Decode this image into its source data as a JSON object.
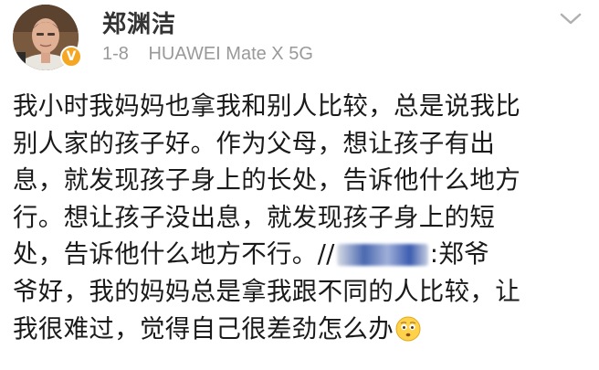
{
  "post": {
    "username": "郑渊洁",
    "time": "1-8",
    "device": "HUAWEI Mate X 5G",
    "verified_badge": "V",
    "icons": {
      "avatar": "user-avatar",
      "verified": "verified-badge-icon",
      "more": "chevron-down-icon",
      "emoji": "sad-face-emoji-icon"
    },
    "colors": {
      "username": "#333333",
      "meta": "#999999",
      "text": "#1a1a1a",
      "verified": "#f5a623"
    },
    "body_lines": [
      "我小时我妈妈也拿我和别人比较，总是说我比",
      "别人家的孩子好。作为父母，想让孩子有出",
      "息，就发现孩子身上的长处，告诉他什么地方",
      "行。想让孩子没出息，就发现孩子身上的短"
    ],
    "line5_before": "处，告诉他什么地方不行。//",
    "line5_after": ":郑爷",
    "line6": "爷好，我的妈妈总是拿我跟不同的人比较，让",
    "line7": "我很难过，觉得自己很差劲怎么办"
  }
}
